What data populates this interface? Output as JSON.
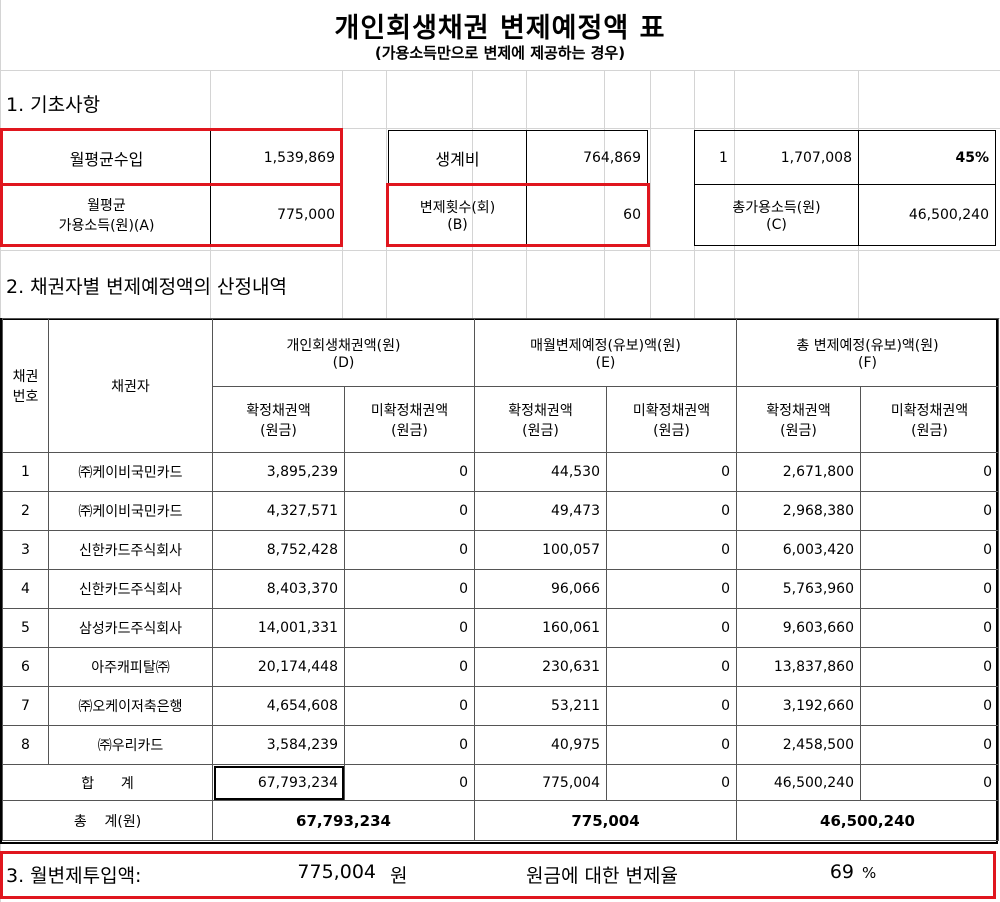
{
  "title": "개인회생채권 변제예정액 표",
  "subtitle": "(가용소득만으로 변제에 제공하는 경우)",
  "section1": "1. 기초사항",
  "basic": {
    "monthly_income_label": "월평균수입",
    "monthly_income_value": "1,539,869",
    "avail_income_label_1": "월평균",
    "avail_income_label_2": "가용소득(원)(A)",
    "avail_income_value": "775,000",
    "living_cost_label": "생계비",
    "living_cost_value": "764,869",
    "repay_count_label_1": "변제횟수(회)",
    "repay_count_label_2": "(B)",
    "repay_count_value": "60",
    "misc_index": "1",
    "misc_value": "1,707,008",
    "misc_percent": "45%",
    "total_avail_label_1": "총가용소득(원)",
    "total_avail_label_2": "(C)",
    "total_avail_value": "46,500,240"
  },
  "section2": "2. 채권자별 변제예정액의 산정내역",
  "table": {
    "col_no_1": "채권",
    "col_no_2": "번호",
    "col_creditor": "채권자",
    "group_d_1": "개인회생채권액(원)",
    "group_d_2": "(D)",
    "group_e_1": "매월변제예정(유보)액(원)",
    "group_e_2": "(E)",
    "group_f_1": "총 변제예정(유보)액(원)",
    "group_f_2": "(F)",
    "sub_confirmed_1": "확정채권액",
    "sub_confirmed_2": "(원금)",
    "sub_unconfirmed_1": "미확정채권액",
    "sub_unconfirmed_2": "(원금)",
    "rows": [
      {
        "no": "1",
        "name": "㈜케이비국민카드",
        "d1": "3,895,239",
        "d2": "0",
        "e1": "44,530",
        "e2": "0",
        "f1": "2,671,800",
        "f2": "0"
      },
      {
        "no": "2",
        "name": "㈜케이비국민카드",
        "d1": "4,327,571",
        "d2": "0",
        "e1": "49,473",
        "e2": "0",
        "f1": "2,968,380",
        "f2": "0"
      },
      {
        "no": "3",
        "name": "신한카드주식회사",
        "d1": "8,752,428",
        "d2": "0",
        "e1": "100,057",
        "e2": "0",
        "f1": "6,003,420",
        "f2": "0"
      },
      {
        "no": "4",
        "name": "신한카드주식회사",
        "d1": "8,403,370",
        "d2": "0",
        "e1": "96,066",
        "e2": "0",
        "f1": "5,763,960",
        "f2": "0"
      },
      {
        "no": "5",
        "name": "삼성카드주식회사",
        "d1": "14,001,331",
        "d2": "0",
        "e1": "160,061",
        "e2": "0",
        "f1": "9,603,660",
        "f2": "0"
      },
      {
        "no": "6",
        "name": "아주캐피탈㈜",
        "d1": "20,174,448",
        "d2": "0",
        "e1": "230,631",
        "e2": "0",
        "f1": "13,837,860",
        "f2": "0"
      },
      {
        "no": "7",
        "name": "㈜오케이저축은행",
        "d1": "4,654,608",
        "d2": "0",
        "e1": "53,211",
        "e2": "0",
        "f1": "3,192,660",
        "f2": "0"
      },
      {
        "no": "8",
        "name": "㈜우리카드",
        "d1": "3,584,239",
        "d2": "0",
        "e1": "40,975",
        "e2": "0",
        "f1": "2,458,500",
        "f2": "0"
      }
    ],
    "sum_label": "합      계",
    "sum": {
      "d1": "67,793,234",
      "d2": "0",
      "e1": "775,004",
      "e2": "0",
      "f1": "46,500,240",
      "f2": "0"
    },
    "total_label": "총    계(원)",
    "total": {
      "d": "67,793,234",
      "e": "775,004",
      "f": "46,500,240"
    }
  },
  "section3": {
    "label": "3. 월변제투입액:",
    "value": "775,004",
    "unit": "원",
    "rate_label": "원금에 대한 변제율",
    "rate_value": "69",
    "rate_unit": "%"
  }
}
